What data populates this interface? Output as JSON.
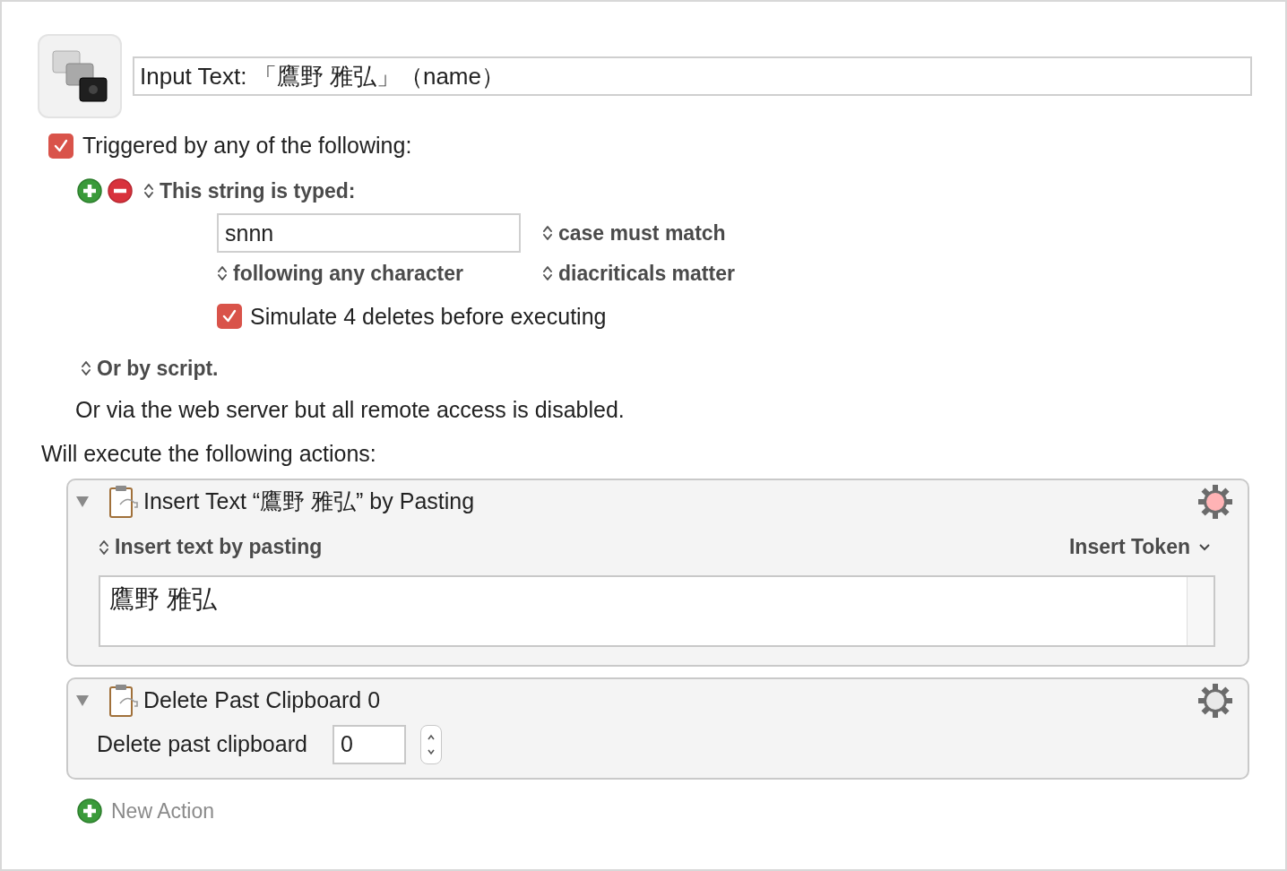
{
  "macro": {
    "name": "Input Text: 「鷹野 雅弘」（name）"
  },
  "trigger": {
    "enabled": true,
    "label": "Triggered by any of the following:"
  },
  "string_trigger": {
    "type_popup": "This string is typed:",
    "value": "snnn",
    "case_popup": "case must match",
    "position_popup": "following any character",
    "diacritics_popup": "diacriticals matter",
    "simulate": {
      "checked": true,
      "label": "Simulate 4 deletes before executing"
    }
  },
  "script_trigger": {
    "popup": "Or by script."
  },
  "web_server_note": "Or via the web server but all remote access is disabled.",
  "actions_heading": "Will execute the following actions:",
  "actions": [
    {
      "kind": "insert",
      "expanded": true,
      "highlighted": true,
      "title": "Insert Text “鷹野 雅弘” by Pasting",
      "mode_popup": "Insert text by pasting",
      "token_menu": "Insert Token",
      "text": "鷹野 雅弘"
    },
    {
      "kind": "delete",
      "expanded": true,
      "highlighted": false,
      "title": "Delete Past Clipboard 0",
      "label": "Delete past clipboard",
      "value": "0"
    }
  ],
  "new_action": "New Action"
}
